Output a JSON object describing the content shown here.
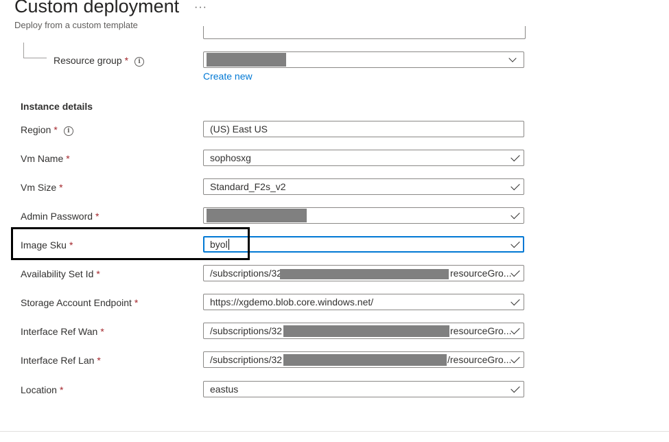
{
  "header": {
    "title": "Custom deployment",
    "more_icon": "···",
    "subtitle": "Deploy from a custom template"
  },
  "resource_group": {
    "label": "Resource group",
    "required": "*",
    "info_icon": "i",
    "create_new_link": "Create new"
  },
  "instance_details": {
    "title": "Instance details",
    "region": {
      "label": "Region",
      "required": "*",
      "info_icon": "i",
      "value": "(US) East US"
    },
    "vm_name": {
      "label": "Vm Name",
      "required": "*",
      "value": "sophosxg"
    },
    "vm_size": {
      "label": "Vm Size",
      "required": "*",
      "value": "Standard_F2s_v2"
    },
    "admin_password": {
      "label": "Admin Password",
      "required": "*"
    },
    "image_sku": {
      "label": "Image Sku",
      "required": "*",
      "value": "byol"
    },
    "availability_set_id": {
      "label": "Availability Set Id",
      "required": "*",
      "value_prefix": "/subscriptions/32",
      "value_suffix": "resourceGro..."
    },
    "storage_account_endpoint": {
      "label": "Storage Account Endpoint",
      "required": "*",
      "value": "https://xgdemo.blob.core.windows.net/"
    },
    "interface_ref_wan": {
      "label": "Interface Ref Wan",
      "required": "*",
      "value_prefix": "/subscriptions/32",
      "value_suffix": "resourceGro..."
    },
    "interface_ref_lan": {
      "label": "Interface Ref Lan",
      "required": "*",
      "value_prefix": "/subscriptions/32",
      "value_suffix": "/resourceGro..."
    },
    "location": {
      "label": "Location",
      "required": "*",
      "value": "eastus"
    }
  },
  "colors": {
    "accent": "#0078d4",
    "required": "#a4262c",
    "redaction": "#808080",
    "highlight": "#000000"
  }
}
